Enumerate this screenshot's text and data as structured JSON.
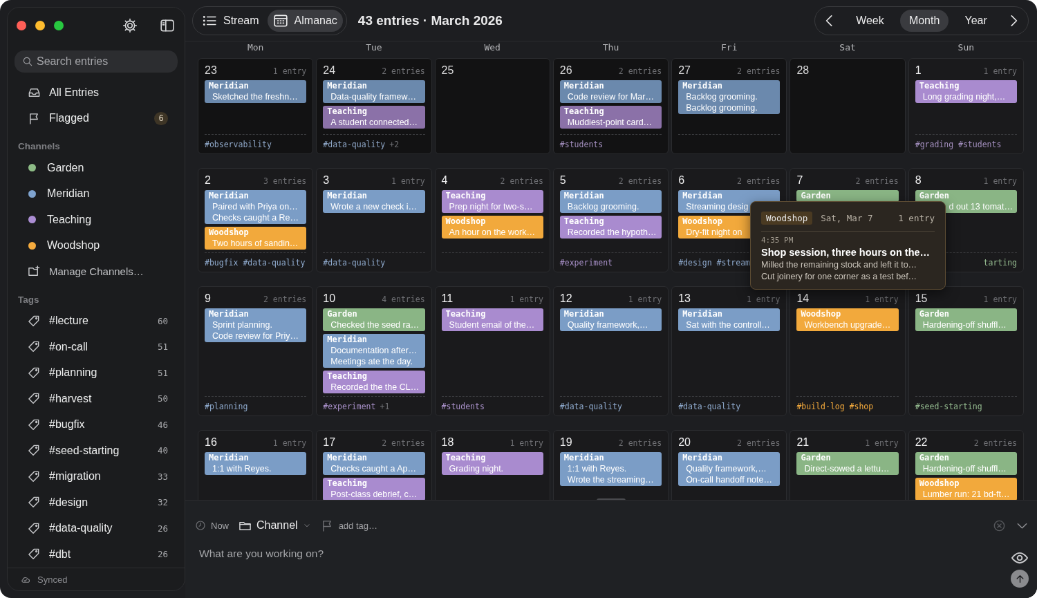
{
  "window": {
    "title": "43 entries · March 2026"
  },
  "sidebar": {
    "search": {
      "placeholder": "Search entries"
    },
    "items": [
      {
        "kind": "inbox",
        "label": "All Entries"
      },
      {
        "kind": "flag",
        "label": "Flagged",
        "badge": "6"
      }
    ],
    "channels_header": "Channels",
    "channels": [
      {
        "name": "Garden",
        "color": "#8dbb86"
      },
      {
        "name": "Meridian",
        "color": "#7fa3cf"
      },
      {
        "name": "Teaching",
        "color": "#ab8dd3"
      },
      {
        "name": "Woodshop",
        "color": "#f5ab3e"
      }
    ],
    "manage": "Manage Channels…",
    "tags_header": "Tags",
    "tags": [
      {
        "label": "#lecture",
        "count": "60"
      },
      {
        "label": "#on-call",
        "count": "51"
      },
      {
        "label": "#planning",
        "count": "51"
      },
      {
        "label": "#harvest",
        "count": "50"
      },
      {
        "label": "#bugfix",
        "count": "46"
      },
      {
        "label": "#seed-starting",
        "count": "40"
      },
      {
        "label": "#migration",
        "count": "33"
      },
      {
        "label": "#design",
        "count": "32"
      },
      {
        "label": "#data-quality",
        "count": "26"
      },
      {
        "label": "#dbt",
        "count": "26"
      }
    ],
    "sync": "Synced"
  },
  "view_switch": [
    {
      "kind": "list",
      "label": "Stream",
      "selected": false
    },
    {
      "kind": "calendar",
      "label": "Almanac",
      "selected": true
    }
  ],
  "range": [
    {
      "label": "Week",
      "selected": false
    },
    {
      "label": "Month",
      "selected": true
    },
    {
      "label": "Year",
      "selected": false
    }
  ],
  "calendar": {
    "weekdays": [
      "Mon",
      "Tue",
      "Wed",
      "Thu",
      "Fri",
      "Sat",
      "Sun"
    ],
    "weeks": [
      [
        {
          "day": "23",
          "count": "1 entry",
          "outside_month": true,
          "entries": [
            {
              "channel": "Meridian",
              "color": "#6b89ad",
              "lines": [
                "Sketched the freshn…"
              ]
            }
          ],
          "tags": {
            "text": "#observability",
            "color": "#8ea6c6"
          }
        },
        {
          "day": "24",
          "count": "2 entries",
          "outside_month": true,
          "entries": [
            {
              "channel": "Meridian",
              "color": "#6b89ad",
              "lines": [
                "Data-quality framew…"
              ]
            },
            {
              "channel": "Teaching",
              "color": "#8b71a8",
              "lines": [
                "A student connected…"
              ]
            }
          ],
          "tags": {
            "text": "#data-quality",
            "color": "#8ea6c6",
            "more": "+2"
          }
        },
        {
          "day": "25",
          "outside_month": true
        },
        {
          "day": "26",
          "count": "2 entries",
          "outside_month": true,
          "entries": [
            {
              "channel": "Meridian",
              "color": "#6b89ad",
              "lines": [
                "Code review for Mar…"
              ]
            },
            {
              "channel": "Teaching",
              "color": "#8b71a8",
              "lines": [
                "Muddiest-point card…"
              ]
            }
          ],
          "tags": {
            "text": "#students",
            "color": "#a28ebd"
          }
        },
        {
          "day": "27",
          "count": "2 entries",
          "outside_month": true,
          "entries": [
            {
              "channel": "Meridian",
              "color": "#6b89ad",
              "lines": [
                "Backlog grooming.",
                "Backlog grooming."
              ]
            }
          ]
        },
        {
          "day": "28",
          "outside_month": true
        },
        {
          "day": "1",
          "count": "1 entry",
          "outside_month": false,
          "entries": [
            {
              "channel": "Teaching",
              "color": "#a98bcf",
              "lines": [
                "Long grading night,…"
              ]
            }
          ],
          "tags": {
            "text": "#grading #students",
            "color": "#a28ebd"
          }
        }
      ],
      [
        {
          "day": "2",
          "count": "3 entries",
          "outside_month": false,
          "entries": [
            {
              "channel": "Meridian",
              "color": "#7b9dc6",
              "lines": [
                "Paired with Priya on…",
                "Checks caught a Re…"
              ]
            },
            {
              "channel": "Woodshop",
              "color": "#f2a93c",
              "lines": [
                "Two hours of sandin…"
              ]
            }
          ],
          "tags": {
            "text": "#bugfix #data-quality",
            "color": "#8ea9cc"
          }
        },
        {
          "day": "3",
          "count": "1 entry",
          "outside_month": false,
          "entries": [
            {
              "channel": "Meridian",
              "color": "#7b9dc6",
              "lines": [
                "Wrote a new check i…"
              ]
            }
          ],
          "tags": {
            "text": "#data-quality",
            "color": "#8ea9cc"
          }
        },
        {
          "day": "4",
          "count": "2 entries",
          "outside_month": false,
          "entries": [
            {
              "channel": "Teaching",
              "color": "#a98bcf",
              "lines": [
                "Prep night for two-s…"
              ]
            },
            {
              "channel": "Woodshop",
              "color": "#f2a93c",
              "lines": [
                "An hour on the work…"
              ]
            }
          ]
        },
        {
          "day": "5",
          "count": "2 entries",
          "outside_month": false,
          "entries": [
            {
              "channel": "Meridian",
              "color": "#7b9dc6",
              "lines": [
                "Backlog grooming."
              ]
            },
            {
              "channel": "Teaching",
              "color": "#a98bcf",
              "lines": [
                "Recorded the hypoth…"
              ]
            }
          ],
          "tags": {
            "text": "#experiment",
            "color": "#a890c8"
          }
        },
        {
          "day": "6",
          "count": "2 entries",
          "outside_month": false,
          "entries": [
            {
              "channel": "Meridian",
              "color": "#7b9dc6",
              "lines": [
                "Streaming desig"
              ]
            },
            {
              "channel": "Woodshop",
              "color": "#f2a93c",
              "lines": [
                "Dry-fit night on"
              ]
            }
          ],
          "tags": {
            "text": "#design #stream",
            "color": "#8ea9cc"
          }
        },
        {
          "day": "7",
          "count": "2 entries",
          "outside_month": false,
          "entries": [
            {
              "channel": "Garden",
              "color": "#8ab585"
            }
          ]
        },
        {
          "day": "8",
          "count": "1 entry",
          "outside_month": false,
          "entries": [
            {
              "channel": "Garden",
              "color": "#8ab585",
              "lines": [
                "d out 13 tomat…"
              ],
              "cut_start": true
            }
          ],
          "tags": {
            "text": "tarting",
            "color": "#93b98e",
            "cut_start": true
          }
        }
      ],
      [
        {
          "day": "9",
          "count": "2 entries",
          "outside_month": false,
          "entries": [
            {
              "channel": "Meridian",
              "color": "#7b9dc6",
              "lines": [
                "Sprint planning.",
                "Code review for Priy…"
              ]
            }
          ],
          "tags": {
            "text": "#planning",
            "color": "#8ea9cc"
          }
        },
        {
          "day": "10",
          "count": "4 entries",
          "outside_month": false,
          "entries": [
            {
              "channel": "Garden",
              "color": "#8ab585",
              "lines": [
                "Checked the seed ra…"
              ]
            },
            {
              "channel": "Meridian",
              "color": "#7b9dc6",
              "lines": [
                "Documentation after…",
                "Meetings ate the day."
              ]
            },
            {
              "channel": "Teaching",
              "color": "#a98bcf",
              "lines": [
                "Recorded the the CL…"
              ]
            }
          ],
          "tags": {
            "text": "#experiment",
            "color": "#a890c8",
            "more": "+1"
          }
        },
        {
          "day": "11",
          "count": "1 entry",
          "outside_month": false,
          "entries": [
            {
              "channel": "Teaching",
              "color": "#a98bcf",
              "lines": [
                "Student email of the…"
              ]
            }
          ],
          "tags": {
            "text": "#students",
            "color": "#a890c8"
          }
        },
        {
          "day": "12",
          "count": "1 entry",
          "outside_month": false,
          "entries": [
            {
              "channel": "Meridian",
              "color": "#7b9dc6",
              "lines": [
                "Quality framework,…"
              ]
            }
          ],
          "tags": {
            "text": "#data-quality",
            "color": "#8ea9cc"
          }
        },
        {
          "day": "13",
          "count": "1 entry",
          "outside_month": false,
          "entries": [
            {
              "channel": "Meridian",
              "color": "#7b9dc6",
              "lines": [
                "Sat with the controll…"
              ]
            }
          ],
          "tags": {
            "text": "#data-quality",
            "color": "#8ea9cc"
          }
        },
        {
          "day": "14",
          "count": "1 entry",
          "outside_month": false,
          "entries": [
            {
              "channel": "Woodshop",
              "color": "#f2a93c",
              "lines": [
                "Workbench upgrade…"
              ]
            }
          ],
          "tags": {
            "text": "#build-log #shop",
            "color": "#f2a93c"
          }
        },
        {
          "day": "15",
          "count": "1 entry",
          "outside_month": false,
          "entries": [
            {
              "channel": "Garden",
              "color": "#8ab585",
              "lines": [
                "Hardening-off shuffl…"
              ]
            }
          ],
          "tags": {
            "text": "#seed-starting",
            "color": "#93b98e"
          }
        }
      ],
      [
        {
          "day": "16",
          "count": "1 entry",
          "outside_month": false,
          "entries": [
            {
              "channel": "Meridian",
              "color": "#7b9dc6",
              "lines": [
                "1:1 with Reyes."
              ]
            }
          ]
        },
        {
          "day": "17",
          "count": "2 entries",
          "outside_month": false,
          "entries": [
            {
              "channel": "Meridian",
              "color": "#7b9dc6",
              "lines": [
                "Checks caught a Ap…"
              ]
            },
            {
              "channel": "Teaching",
              "color": "#a98bcf",
              "lines": [
                "Post-class debrief, c…"
              ]
            }
          ]
        },
        {
          "day": "18",
          "count": "1 entry",
          "outside_month": false,
          "entries": [
            {
              "channel": "Teaching",
              "color": "#a98bcf",
              "lines": [
                "Grading night."
              ]
            }
          ]
        },
        {
          "day": "19",
          "count": "2 entries",
          "outside_month": false,
          "entries": [
            {
              "channel": "Meridian",
              "color": "#7b9dc6",
              "lines": [
                "1:1 with Reyes.",
                "Wrote the streaming…"
              ]
            }
          ]
        },
        {
          "day": "20",
          "count": "2 entries",
          "outside_month": false,
          "entries": [
            {
              "channel": "Meridian",
              "color": "#7b9dc6",
              "lines": [
                "Quality framework,…",
                "On-call handoff note…"
              ]
            }
          ]
        },
        {
          "day": "21",
          "count": "1 entry",
          "outside_month": false,
          "entries": [
            {
              "channel": "Garden",
              "color": "#8ab585",
              "lines": [
                "Direct-sowed a lettu…"
              ]
            }
          ]
        },
        {
          "day": "22",
          "count": "2 entries",
          "outside_month": false,
          "entries": [
            {
              "channel": "Garden",
              "color": "#8ab585",
              "lines": [
                "Hardening-off shuffl…"
              ]
            },
            {
              "channel": "Woodshop",
              "color": "#f2a93c",
              "lines": [
                "Lumber run: 21 bd-ft…"
              ]
            }
          ]
        }
      ]
    ],
    "tooltip": {
      "channel": "Woodshop",
      "date": "Sat, Mar 7",
      "count": "1 entry",
      "time": "4:35 PM",
      "title": "Shop session, three hours on the…",
      "lines": [
        "Milled the remaining stock and left it to…",
        "Cut joinery for one corner as a test bef…"
      ]
    }
  },
  "composer": {
    "time": "Now",
    "channel": "Channel",
    "tag_placeholder": "add tag…",
    "placeholder": "What are you working on?"
  }
}
